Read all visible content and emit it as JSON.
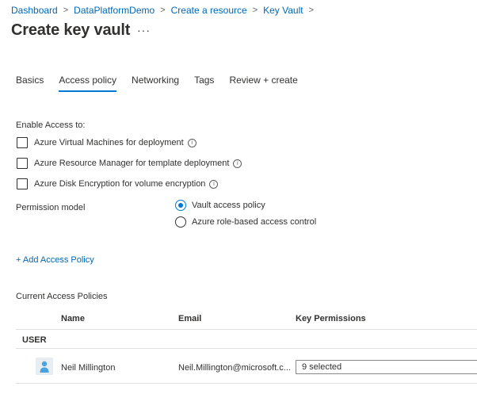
{
  "breadcrumb": {
    "items": [
      "Dashboard",
      "DataPlatformDemo",
      "Create a resource",
      "Key Vault"
    ]
  },
  "page": {
    "title": "Create key vault",
    "more_label": "···"
  },
  "tabs": [
    {
      "label": "Basics",
      "active": false
    },
    {
      "label": "Access policy",
      "active": true
    },
    {
      "label": "Networking",
      "active": false
    },
    {
      "label": "Tags",
      "active": false
    },
    {
      "label": "Review + create",
      "active": false
    }
  ],
  "enable_access": {
    "label": "Enable Access to:",
    "options": [
      {
        "label": "Azure Virtual Machines for deployment",
        "checked": false
      },
      {
        "label": "Azure Resource Manager for template deployment",
        "checked": false
      },
      {
        "label": "Azure Disk Encryption for volume encryption",
        "checked": false
      }
    ]
  },
  "permission_model": {
    "label": "Permission model",
    "options": [
      {
        "label": "Vault access policy",
        "selected": true
      },
      {
        "label": "Azure role-based access control",
        "selected": false
      }
    ]
  },
  "add_policy": {
    "label": "+ Add Access Policy"
  },
  "policies": {
    "heading": "Current Access Policies",
    "columns": [
      "Name",
      "Email",
      "Key Permissions"
    ],
    "group_label": "USER",
    "rows": [
      {
        "name": "Neil Millington",
        "email": "Neil.Millington@microsoft.c...",
        "key_permissions": "9 selected"
      }
    ]
  },
  "colors": {
    "accent": "#0078d4",
    "link": "#0067b8",
    "text": "#323130",
    "avatar": "#4aa3df"
  }
}
